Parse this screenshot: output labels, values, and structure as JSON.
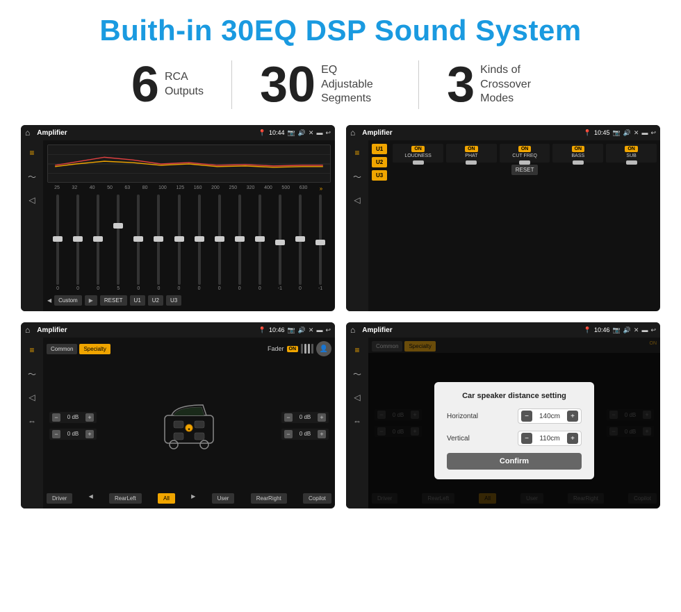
{
  "title": "Buith-in 30EQ DSP Sound System",
  "stats": [
    {
      "number": "6",
      "label": "RCA\nOutputs"
    },
    {
      "number": "30",
      "label": "EQ Adjustable\nSegments"
    },
    {
      "number": "3",
      "label": "Kinds of\nCrossover Modes"
    }
  ],
  "screens": [
    {
      "id": "eq-screen",
      "topbar": {
        "title": "Amplifier",
        "time": "10:44"
      },
      "type": "eq",
      "frequencies": [
        "25",
        "32",
        "40",
        "50",
        "63",
        "80",
        "100",
        "125",
        "160",
        "200",
        "250",
        "320",
        "400",
        "500",
        "630"
      ],
      "values": [
        "0",
        "0",
        "0",
        "5",
        "0",
        "0",
        "0",
        "0",
        "0",
        "0",
        "0",
        "-1",
        "0",
        "-1"
      ],
      "buttons": [
        "Custom",
        "RESET",
        "U1",
        "U2",
        "U3"
      ]
    },
    {
      "id": "amp-screen",
      "topbar": {
        "title": "Amplifier",
        "time": "10:45"
      },
      "type": "amplifier",
      "presets": [
        "U1",
        "U2",
        "U3"
      ],
      "channels": [
        {
          "name": "LOUDNESS",
          "on": true
        },
        {
          "name": "PHAT",
          "on": true
        },
        {
          "name": "CUT FREQ",
          "on": true
        },
        {
          "name": "BASS",
          "on": true
        },
        {
          "name": "SUB",
          "on": true
        }
      ],
      "reset_btn": "RESET"
    },
    {
      "id": "fader-screen",
      "topbar": {
        "title": "Amplifier",
        "time": "10:46"
      },
      "type": "fader",
      "tabs": [
        "Common",
        "Specialty"
      ],
      "active_tab": "Specialty",
      "fader_label": "Fader",
      "fader_on": "ON",
      "left_controls": [
        {
          "label": "0 dB"
        },
        {
          "label": "0 dB"
        }
      ],
      "right_controls": [
        {
          "label": "0 dB"
        },
        {
          "label": "0 dB"
        }
      ],
      "bottom_buttons": [
        "Driver",
        "RearLeft",
        "All",
        "User",
        "RearRight",
        "Copilot"
      ]
    },
    {
      "id": "dialog-screen",
      "topbar": {
        "title": "Amplifier",
        "time": "10:46"
      },
      "type": "dialog",
      "tabs": [
        "Common",
        "Specialty"
      ],
      "dialog": {
        "title": "Car speaker distance setting",
        "rows": [
          {
            "label": "Horizontal",
            "value": "140cm"
          },
          {
            "label": "Vertical",
            "value": "110cm"
          }
        ],
        "confirm_btn": "Confirm"
      },
      "bottom_buttons": [
        "Driver",
        "RearLeft",
        "All",
        "User",
        "RearRight",
        "Copilot"
      ]
    }
  ]
}
